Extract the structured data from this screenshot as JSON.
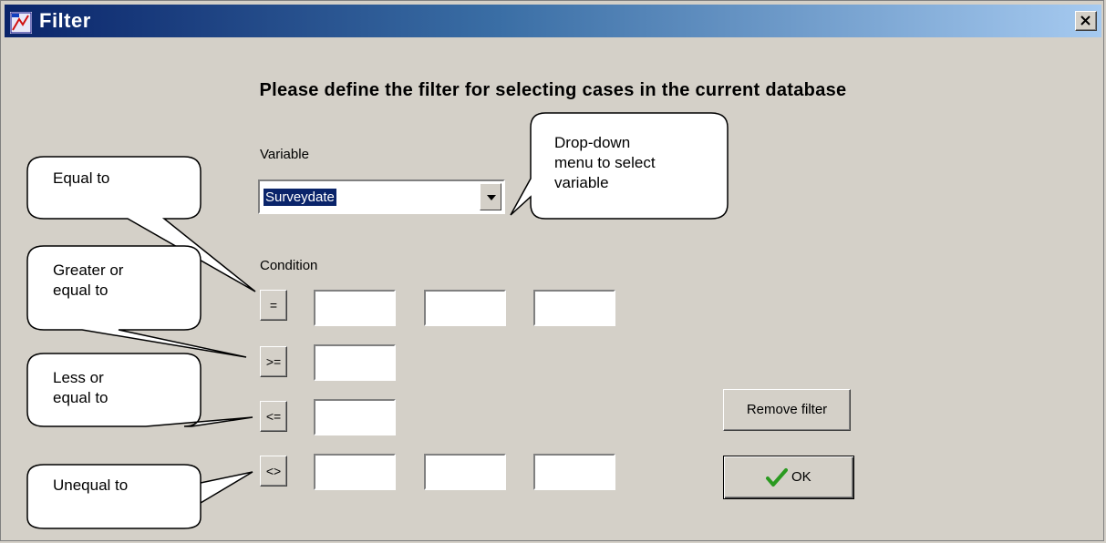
{
  "window": {
    "title": "Filter"
  },
  "heading": "Please define the filter for selecting cases in the current database",
  "variable": {
    "label": "Variable",
    "selected": "Surveydate"
  },
  "condition": {
    "label": "Condition",
    "operators": [
      "=",
      ">=",
      "<=",
      "<>"
    ]
  },
  "buttons": {
    "remove": "Remove filter",
    "ok": "OK"
  },
  "callouts": {
    "equal": "Equal to",
    "greater": [
      "Greater or",
      "equal to"
    ],
    "less": [
      "Less or",
      "equal to"
    ],
    "unequal": "Unequal to",
    "dropdown": [
      "Drop-down",
      "menu to select",
      "variable"
    ]
  }
}
